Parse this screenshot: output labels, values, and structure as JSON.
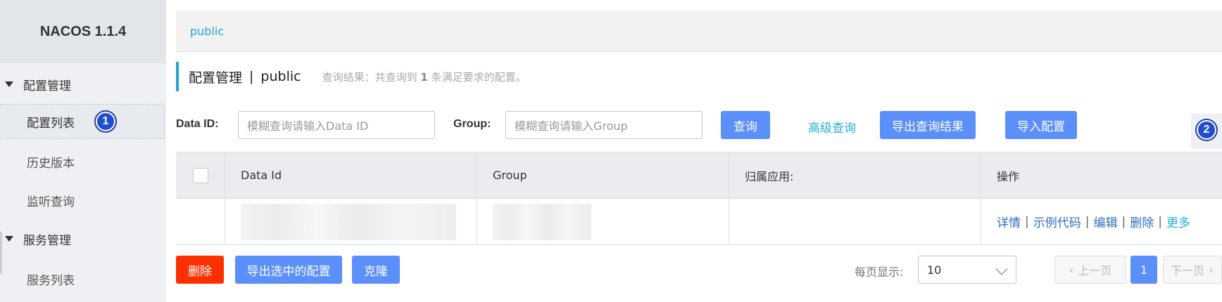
{
  "sidebar": {
    "brand": "NACOS 1.1.4",
    "groups": [
      {
        "title": "配置管理",
        "items": [
          "配置列表",
          "历史版本",
          "监听查询"
        ]
      },
      {
        "title": "服务管理",
        "items": [
          "服务列表"
        ]
      }
    ],
    "badge1": "1"
  },
  "namespace": {
    "tab": "public"
  },
  "heading": {
    "title": "配置管理",
    "separator": "|",
    "namespace": "public",
    "result_prefix": "查询结果：共查询到",
    "result_count": "1",
    "result_suffix": "条满足要求的配置。"
  },
  "filters": {
    "data_id_label": "Data ID:",
    "data_id_placeholder": "模糊查询请输入Data ID",
    "group_label": "Group:",
    "group_placeholder": "模糊查询请输入Group",
    "query_button": "查询",
    "advanced_query": "高级查询",
    "export_results": "导出查询结果",
    "import_config": "导入配置"
  },
  "add": {
    "plus": "+",
    "badge2": "2"
  },
  "table": {
    "headers": [
      "Data Id",
      "Group",
      "归属应用:",
      "操作"
    ],
    "row_actions": [
      "详情",
      "示例代码",
      "编辑",
      "删除",
      "更多"
    ],
    "pipe": "|"
  },
  "bottom": {
    "delete": "删除",
    "export_selected": "导出选中的配置",
    "clone": "克隆",
    "per_page_label": "每页显示:",
    "per_page_value": "10",
    "prev": "上一页",
    "page": "1",
    "next": "下一页"
  },
  "colors": {
    "primary": "#5b8ff9",
    "accent": "#21a6d2",
    "danger": "#ff3000",
    "badge": "#1f4fd0"
  }
}
